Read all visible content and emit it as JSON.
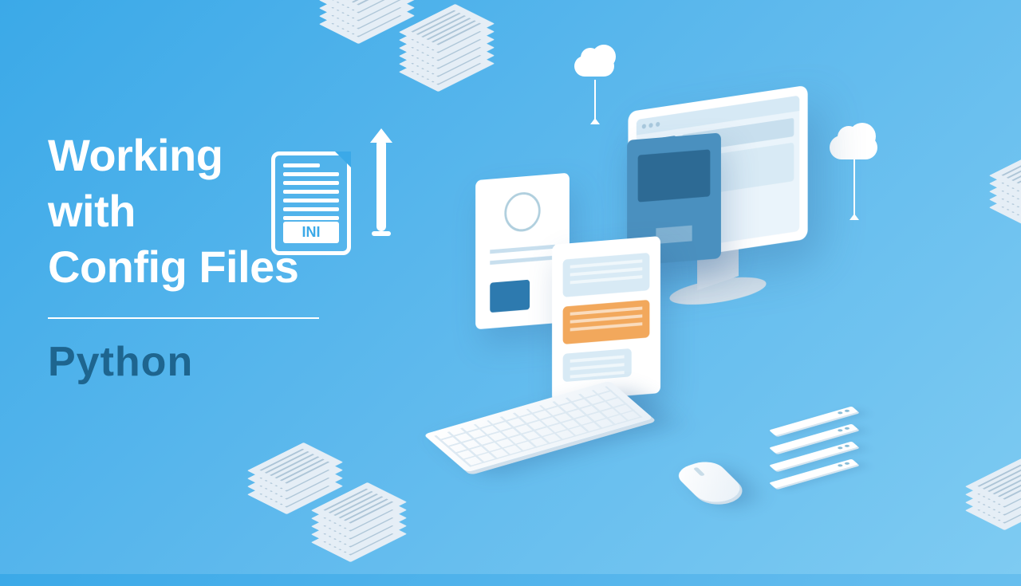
{
  "title": {
    "line1": "Working",
    "line2": "with",
    "line3": "Config Files"
  },
  "subtitle": "Python",
  "file_icon_label": "INI"
}
